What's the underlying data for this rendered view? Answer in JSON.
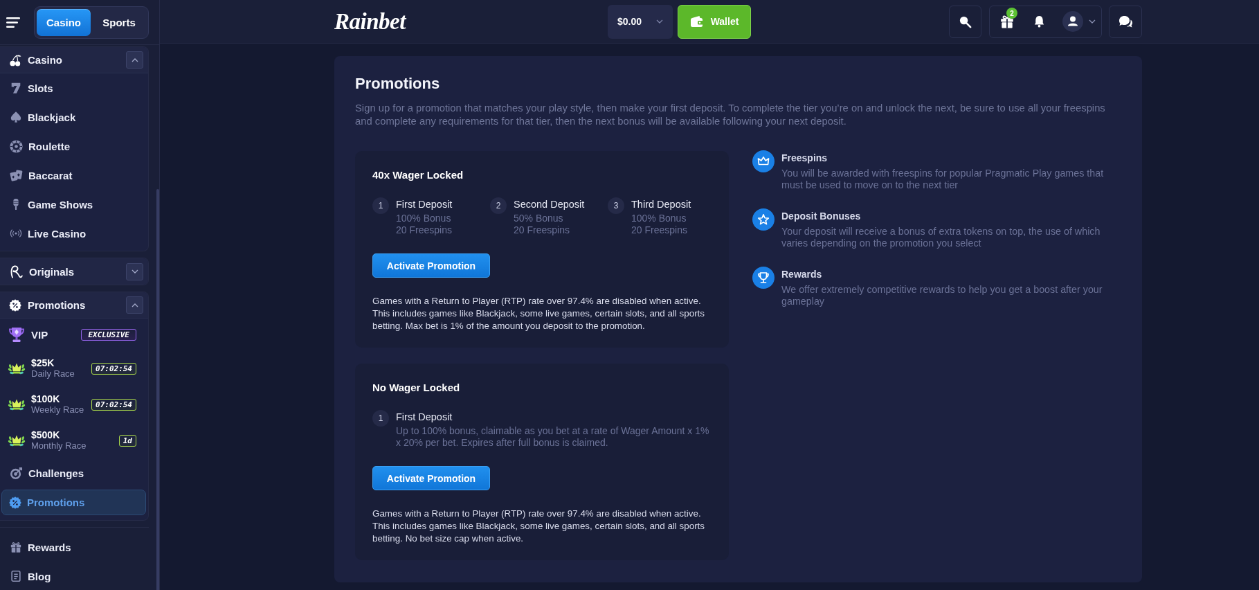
{
  "header": {
    "logo": "Rainbet",
    "balance": "$0.00",
    "wallet_button": "Wallet",
    "gift_count": "2"
  },
  "sidebar": {
    "mode_tabs": [
      {
        "label": "Casino",
        "selected": true
      },
      {
        "label": "Sports",
        "selected": false
      }
    ],
    "sections": [
      {
        "label": "Casino",
        "expanded": true,
        "items": [
          {
            "kind": "link",
            "label": "Slots",
            "selected": false
          },
          {
            "kind": "link",
            "label": "Blackjack",
            "selected": false
          },
          {
            "kind": "link",
            "label": "Roulette",
            "selected": false
          },
          {
            "kind": "link",
            "label": "Baccarat",
            "selected": false
          },
          {
            "kind": "link",
            "label": "Game Shows",
            "selected": false
          },
          {
            "kind": "link",
            "label": "Live Casino",
            "selected": false
          }
        ]
      },
      {
        "label": "Originals",
        "expanded": false
      },
      {
        "label": "Promotions",
        "expanded": true,
        "items": [
          {
            "kind": "vip",
            "label": "VIP",
            "badge": "EXCLUSIVE",
            "selected": false
          },
          {
            "kind": "race",
            "prize": "$25K",
            "label": "Daily Race",
            "timer": "07:02:54",
            "selected": false
          },
          {
            "kind": "race",
            "prize": "$100K",
            "label": "Weekly Race",
            "timer": "07:02:54",
            "selected": false
          },
          {
            "kind": "race",
            "prize": "$500K",
            "label": "Monthly Race",
            "timer": "1d",
            "selected": false
          },
          {
            "kind": "link",
            "label": "Challenges",
            "selected": false
          },
          {
            "kind": "link",
            "label": "Promotions",
            "selected": true
          }
        ]
      }
    ],
    "footer_items": [
      {
        "label": "Rewards",
        "selected": false
      },
      {
        "label": "Blog",
        "selected": false
      }
    ]
  },
  "promotions": {
    "title": "Promotions",
    "description": "Sign up for a promotion that matches your play style, then make your first deposit. To complete the tier you’re on and unlock the next, be sure to use all your freespins and complete any requirements for that tier, then the next bonus will be available following your next deposit.",
    "offers": [
      {
        "title": "40x Wager Locked",
        "steps": [
          {
            "number": "1",
            "title": "First Deposit",
            "details": [
              "100% Bonus",
              "20 Freespins"
            ]
          },
          {
            "number": "2",
            "title": "Second Deposit",
            "details": [
              "50% Bonus",
              "20 Freespins"
            ]
          },
          {
            "number": "3",
            "title": "Third Deposit",
            "details": [
              "100% Bonus",
              "20 Freespins"
            ]
          }
        ],
        "button": "Activate Promotion",
        "notice": "Games with a Return to Player (RTP) rate over 97.4% are disabled when active. This includes games like Blackjack, some live games, certain slots, and all sports betting. Max bet is 1% of the amount you deposit to the promotion."
      },
      {
        "title": "No Wager Locked",
        "steps": [
          {
            "number": "1",
            "title": "First Deposit",
            "details": [
              "Up to 100% bonus, claimable as you bet at a rate of Wager Amount x 1% x 20% per bet. Expires after full bonus is claimed."
            ]
          }
        ],
        "button": "Activate Promotion",
        "notice": "Games with a Return to Player (RTP) rate over 97.4% are disabled when active. This includes games like Blackjack, some live games, certain slots, and all sports betting. No bet size cap when active."
      }
    ],
    "features": [
      {
        "title": "Freespins",
        "description": "You will be awarded with freespins for popular Pragmatic Play games that must be used to move on to the next tier"
      },
      {
        "title": "Deposit Bonuses",
        "description": "Your deposit will receive a bonus of extra tokens on top, the use of which varies depending on the promotion you select"
      },
      {
        "title": "Rewards",
        "description": "We offer extremely competitive rewards to help you get a boost after your gameplay"
      }
    ]
  }
}
